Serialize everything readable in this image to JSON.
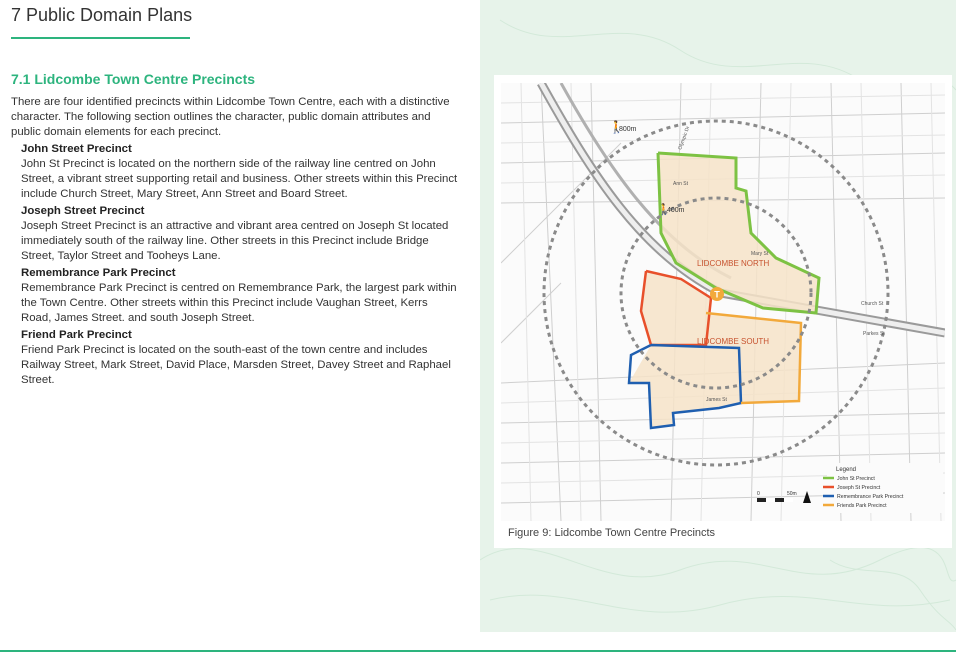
{
  "page": {
    "title": "7 Public Domain Plans"
  },
  "section": {
    "title": "7.1 Lidcombe Town Centre Precincts",
    "intro": "There are four identified precincts within Lidcombe Town Centre, each with a distinctive character. The following section outlines the character, public domain attributes and public domain elements for each precinct."
  },
  "precincts": [
    {
      "heading": "John Street Precinct",
      "text": "John St Precinct is located on the northern side of the railway line centred on John Street, a vibrant street supporting retail and business. Other streets within this Precinct include Church Street, Mary Street, Ann Street and Board Street."
    },
    {
      "heading": "Joseph Street Precinct",
      "text": "Joseph Street Precinct is an attractive and vibrant area centred on Joseph St located immediately south of the railway line. Other streets in this Precinct include Bridge Street, Taylor Street and Tooheys Lane."
    },
    {
      "heading": "Remembrance Park Precinct",
      "text": "Remembrance Park Precinct is centred on Remembrance Park, the largest park within the Town Centre. Other streets within this Precinct include Vaughan Street, Kerrs Road, James Street. and south Joseph Street."
    },
    {
      "heading": "Friend Park Precinct",
      "text": "Friend Park Precinct is located on the south-east of the town centre and includes Railway Street, Mark Street, David Place, Marsden Street, Davey Street and Raphael Street."
    }
  ],
  "figure": {
    "caption": "Figure 9: Lidcombe Town Centre Precincts",
    "labels": {
      "north": "LIDCOMBE NORTH",
      "south": "LIDCOMBE SOUTH",
      "radius_outer": "800m",
      "radius_inner": "400m",
      "station": "T",
      "church_st": "Church St",
      "parkes_st": "Parkes St",
      "mary_st": "Mary St",
      "ann_st": "Ann St",
      "olympic_dr": "Olympic Dr",
      "james_st": "James St",
      "scale_start": "0",
      "scale_end": "50m"
    },
    "legend": {
      "title": "Legend",
      "items": [
        {
          "label": "John St Precinct",
          "color": "#7dc243"
        },
        {
          "label": "Joseph St Precinct",
          "color": "#e8502b"
        },
        {
          "label": "Remembrance Park Precinct",
          "color": "#1f5fb0"
        },
        {
          "label": "Friends Park Precinct",
          "color": "#f2a93b"
        }
      ]
    }
  }
}
